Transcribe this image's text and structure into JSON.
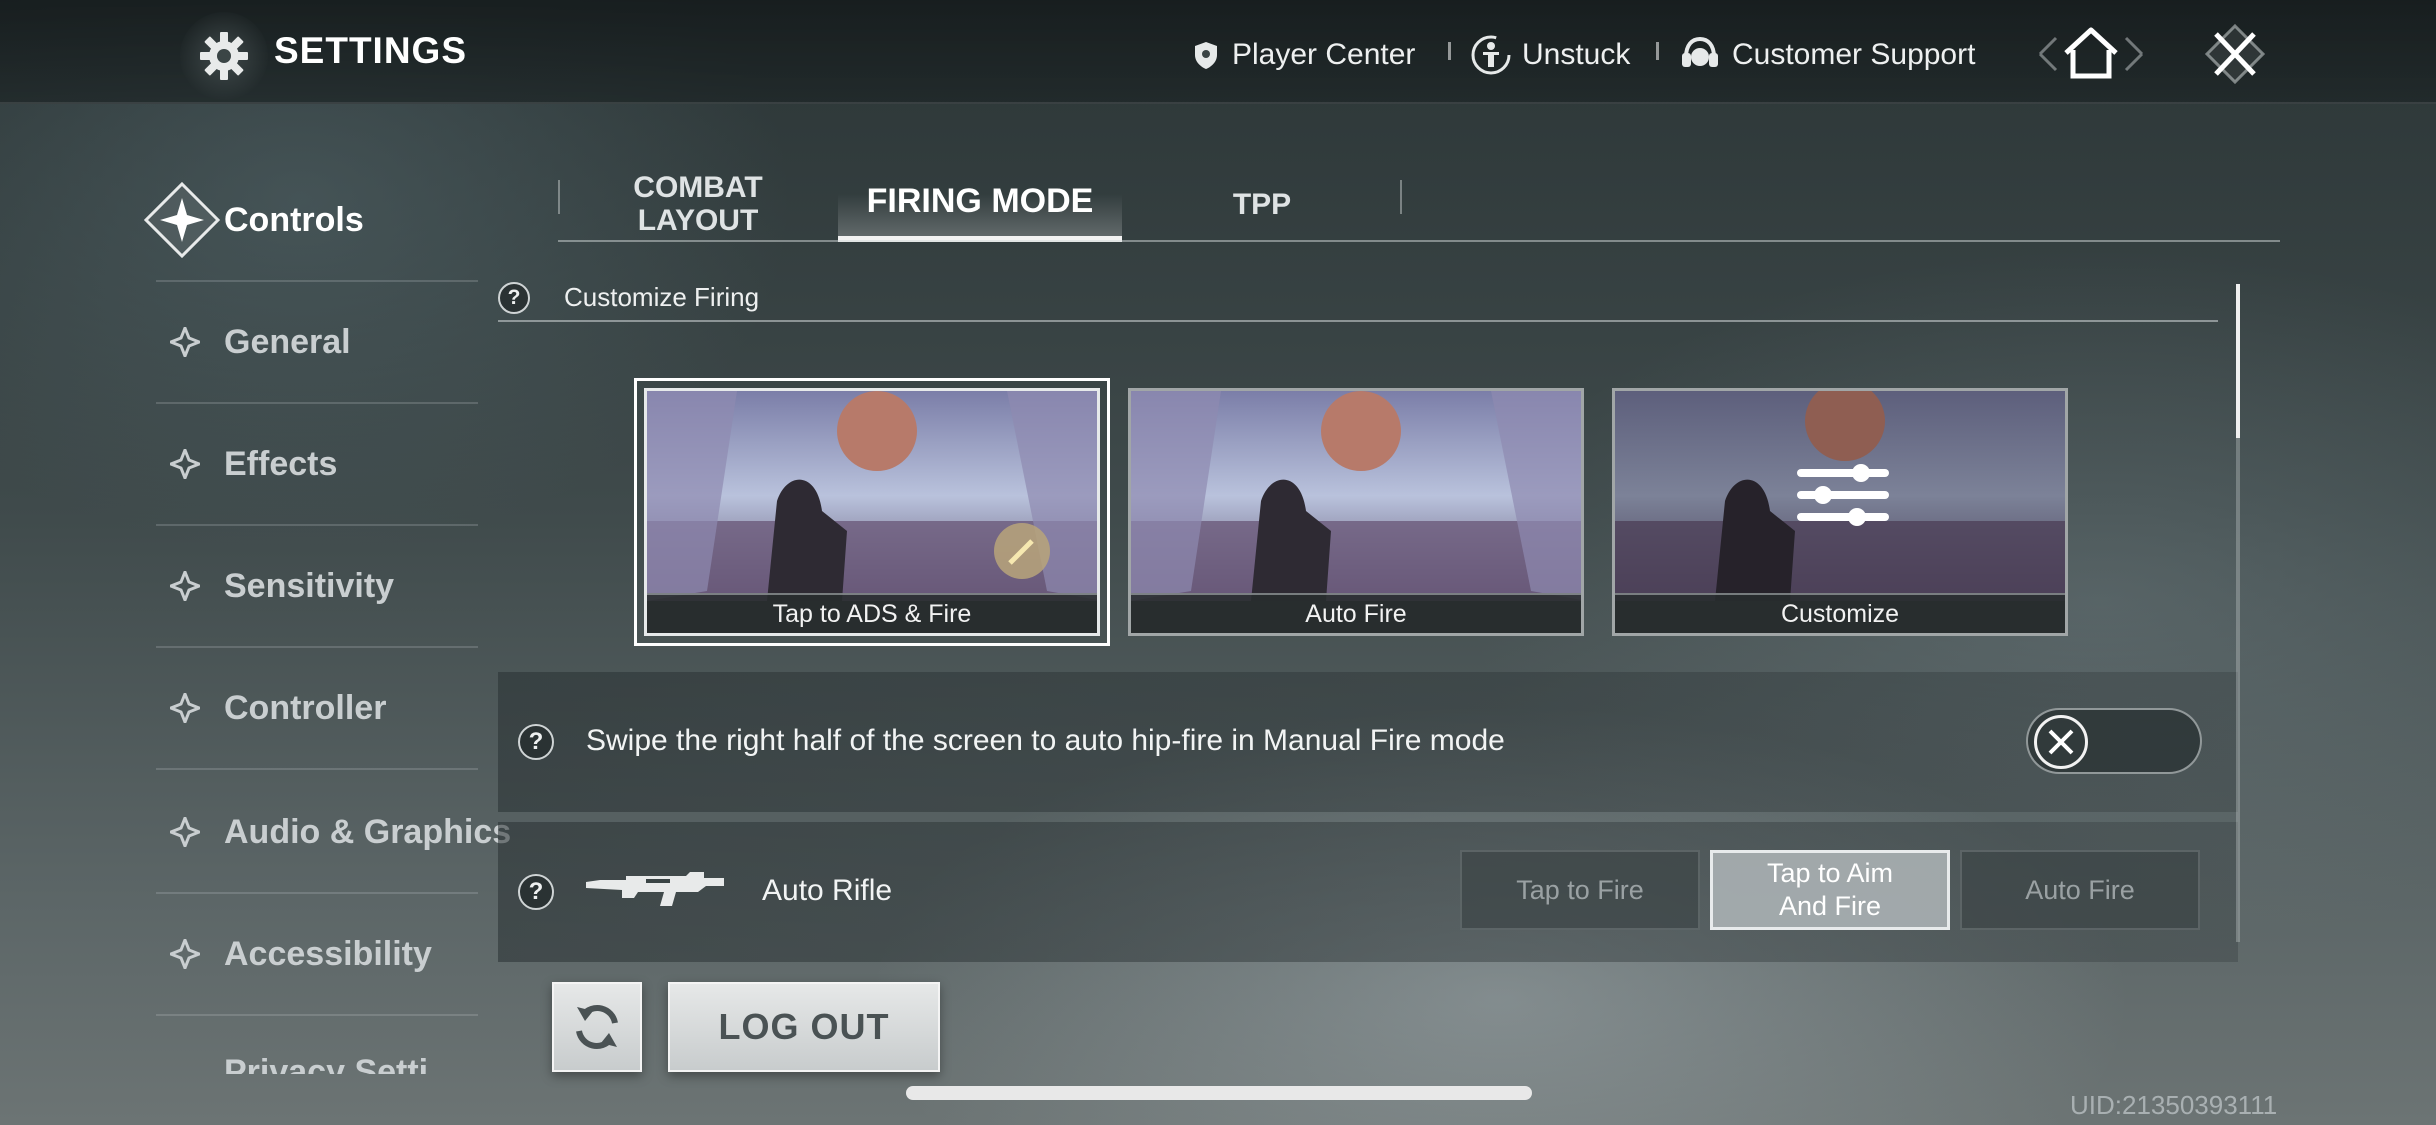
{
  "header": {
    "title": "SETTINGS",
    "nav": {
      "player_center": "Player Center",
      "unstuck": "Unstuck",
      "customer_support": "Customer Support"
    },
    "icons": [
      "gear-icon",
      "shield-icon",
      "person-icon",
      "headset-icon",
      "home-icon",
      "close-icon"
    ]
  },
  "sidebar": {
    "items": [
      {
        "label": "Controls",
        "active": true
      },
      {
        "label": "General"
      },
      {
        "label": "Effects"
      },
      {
        "label": "Sensitivity"
      },
      {
        "label": "Controller"
      },
      {
        "label": "Audio & Graphics"
      },
      {
        "label": "Accessibility"
      },
      {
        "label": "Privacy Setti"
      }
    ]
  },
  "tabs": [
    {
      "label": "COMBAT\nLAYOUT"
    },
    {
      "label": "FIRING MODE",
      "active": true
    },
    {
      "label": "TPP"
    }
  ],
  "section": {
    "help_glyph": "?",
    "title": "Customize Firing"
  },
  "firing_modes": [
    {
      "label": "Tap to ADS & Fire",
      "selected": true
    },
    {
      "label": "Auto Fire"
    },
    {
      "label": "Customize"
    }
  ],
  "swipe_row": {
    "text": "Swipe the right half of the screen to auto hip-fire in Manual Fire mode",
    "enabled": false
  },
  "weapon_row": {
    "weapon": "Auto Rifle",
    "options": [
      {
        "label": "Tap to Fire"
      },
      {
        "label": "Tap to Aim\nAnd Fire",
        "active": true
      },
      {
        "label": "Auto Fire"
      }
    ]
  },
  "footer": {
    "logout": "LOG OUT",
    "uid": "UID:21350393111"
  },
  "colors": {
    "accent": "#ffffff",
    "inactive_text": "#c9ced0",
    "active_segment": "#afb6b8"
  }
}
